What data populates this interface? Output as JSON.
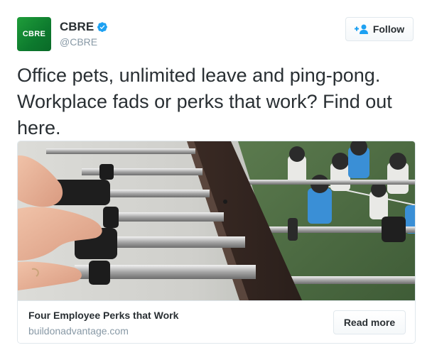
{
  "account": {
    "avatar_text": "CBRE",
    "display_name": "CBRE",
    "handle": "@CBRE",
    "verified": true
  },
  "follow_button": {
    "label": "Follow",
    "icon": "add-user-icon"
  },
  "tweet": {
    "text": "Office pets, unlimited leave and ping-pong. Workplace fads or perks that work? Find out here."
  },
  "card": {
    "image_description_icon": "foosball-photo",
    "title": "Four Employee Perks that Work",
    "domain": "buildonadvantage.com",
    "button_label": "Read more"
  },
  "colors": {
    "brand_green": "#1f9d3a",
    "verified_blue": "#1da1f2",
    "text": "#292f33",
    "muted": "#8899a6",
    "border": "#e1e8ed"
  }
}
